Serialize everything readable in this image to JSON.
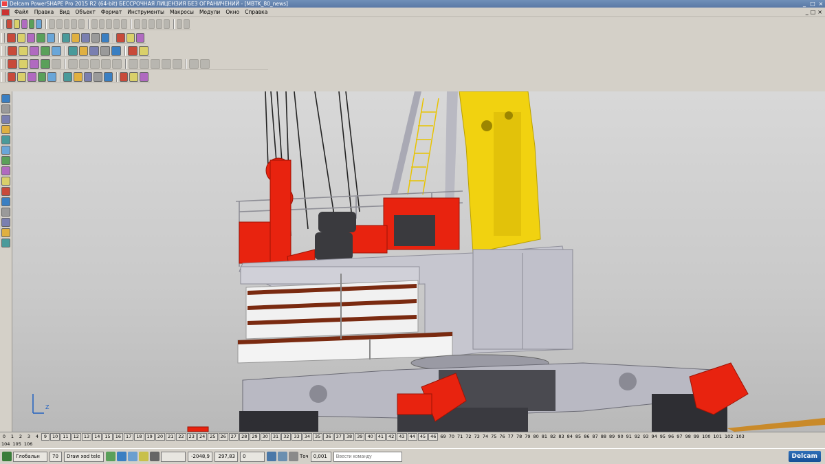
{
  "window": {
    "title": "Delcam PowerSHAPE Pro 2015 R2 (64-bit) БЕССРОЧНАЯ ЛИЦЕНЗИЯ БЕЗ ОГРАНИЧЕНИЙ - [MBTK_80_news]",
    "controls": [
      "_",
      "□",
      "×"
    ]
  },
  "menu": {
    "items": [
      "Файл",
      "Правка",
      "Вид",
      "Объект",
      "Формат",
      "Инструменты",
      "Макросы",
      "Модули",
      "Окно",
      "Справка"
    ],
    "mdi_controls": [
      "_",
      "□",
      "×"
    ]
  },
  "toolbars": {
    "row1_icons": [
      "new-icon",
      "open-icon",
      "save-icon",
      "save-as-icon",
      "print-icon",
      "cut-icon",
      "copy-icon",
      "paste-icon",
      "delete-icon",
      "undo-icon",
      "redo-icon",
      "select-icon",
      "zoom-icon",
      "line-icon",
      "arc-icon",
      "circle-icon",
      "curve-icon",
      "surface-icon",
      "solid-icon",
      "mesh-icon",
      "wireframe-icon",
      "dimension-icon"
    ],
    "row2_icons": [
      "view-top-icon",
      "view-front-icon",
      "view-side-icon",
      "view-iso1-icon",
      "view-iso2-icon",
      "pan-icon",
      "zoom-in-icon",
      "zoom-out-icon",
      "zoom-fit-icon",
      "rotate-icon",
      "shade-icon",
      "light-icon",
      "measure-icon"
    ],
    "row3_icons": [
      "level-icon",
      "workplane-icon",
      "layer-icon",
      "material-icon",
      "color-icon",
      "render-icon",
      "texture-icon",
      "analysis-icon",
      "draft-icon",
      "curvature-icon",
      "section-icon",
      "assembly-icon"
    ],
    "row4_icons": [
      "solid-box-icon",
      "solid-cyl-icon",
      "solid-sphere-icon",
      "solid-cone-icon",
      "solid-torus-icon",
      "solid-extrude-icon",
      "solid-revolve-icon",
      "boolean-add-icon",
      "boolean-sub-icon",
      "boolean-int-icon",
      "fillet-icon",
      "chamfer-icon",
      "shell-icon",
      "split-icon",
      "mirror-icon",
      "pattern-icon",
      "feature-tree-icon"
    ],
    "row5_icons": [
      "edit-icon",
      "transform-icon",
      "move-icon",
      "scale-icon",
      "rotate3d-icon",
      "offset-icon",
      "project-icon",
      "intersect-icon",
      "trim-icon",
      "blend-icon",
      "check-icon",
      "repair-icon",
      "properties-icon"
    ]
  },
  "left_toolbar": {
    "icons": [
      "pointer-icon",
      "select-box-icon",
      "line-tool-icon",
      "warning-icon",
      "arc-tool-icon",
      "curve-tool-icon",
      "surface-tool-icon",
      "solid-tool-icon",
      "mesh-tool-icon",
      "symbol-tool-icon",
      "text-tool-icon",
      "dimension-tool-icon",
      "assembly-tool-icon",
      "color-tool-icon",
      "delete-tool-icon"
    ]
  },
  "viewport": {
    "axis_z_label": "Z",
    "colors": {
      "red": "#e8230f",
      "yellow": "#f1d210",
      "gray": "#c6c6cf",
      "dark": "#444448",
      "wood": "#7a2a10",
      "panel": "#f3f3f3"
    }
  },
  "levels": {
    "row1": [
      "0",
      "1",
      "2",
      "3",
      "4",
      "9",
      "10",
      "11",
      "12",
      "13",
      "14",
      "15",
      "16",
      "17",
      "18",
      "19",
      "20",
      "21",
      "22",
      "23",
      "24",
      "25",
      "26",
      "27",
      "28",
      "29",
      "30",
      "31",
      "32",
      "33",
      "34",
      "35",
      "36",
      "37",
      "38",
      "39",
      "40",
      "41",
      "42",
      "43",
      "44",
      "45",
      "46",
      "69",
      "70",
      "71",
      "72",
      "73",
      "74",
      "75",
      "76",
      "77",
      "78",
      "79",
      "80",
      "81",
      "82",
      "83",
      "84",
      "85",
      "86",
      "87",
      "88",
      "89",
      "90",
      "91",
      "92",
      "93",
      "94",
      "95",
      "96",
      "97",
      "98",
      "99",
      "100",
      "101",
      "102",
      "103"
    ],
    "row2": [
      "104",
      "105",
      "106"
    ]
  },
  "status": {
    "coord_system": "Глобальн",
    "level_num": "70",
    "level_name": "Draw xod tele",
    "x": "-2048,9",
    "y": "297,83",
    "z": "0",
    "tolerance_label": "Точ",
    "tolerance": "0,001",
    "command_placeholder": "Ввести команду",
    "logo": "Delcam"
  }
}
